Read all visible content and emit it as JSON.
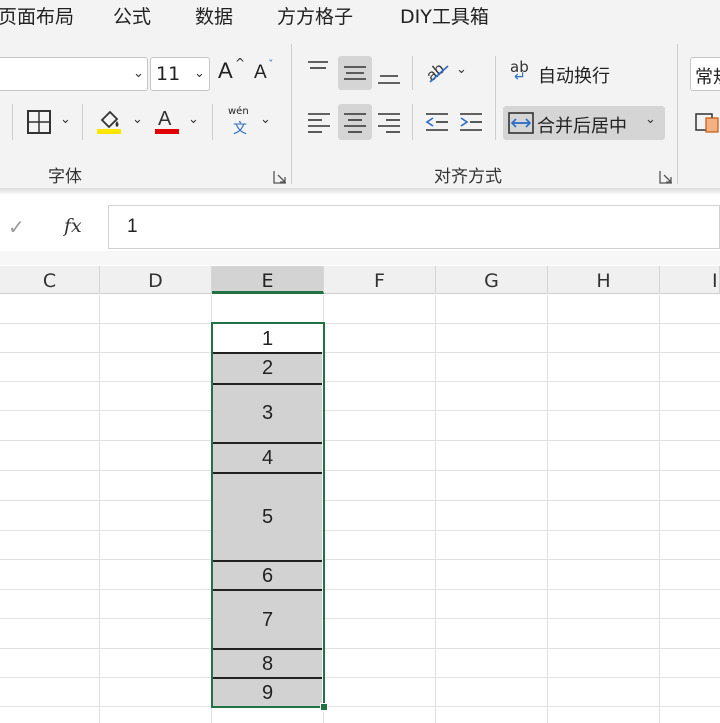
{
  "tabs": [
    "页面布局",
    "公式",
    "数据",
    "方方格子",
    "DIY工具箱"
  ],
  "font": {
    "size": "11",
    "increase_label": "A",
    "decrease_label": "A",
    "group_label": "字体",
    "fill_color": "#ffe600",
    "font_color": "#e00000",
    "phonetic_top": "wén",
    "phonetic_bottom": "文"
  },
  "alignment": {
    "wrap_label": "自动换行",
    "wrap_icon_text": "ab",
    "merge_label": "合并后居中",
    "group_label": "对齐方式"
  },
  "number": {
    "format_value": "常規"
  },
  "formula_bar": {
    "fx_label": "fx",
    "value": "1"
  },
  "columns": [
    "C",
    "D",
    "E",
    "F",
    "G",
    "H",
    "I"
  ],
  "active_column": "E",
  "merged_cells": [
    "1",
    "2",
    "3",
    "4",
    "5",
    "6",
    "7",
    "8",
    "9"
  ],
  "colors": {
    "accent": "#217346",
    "selection_fill": "#d2d2d2"
  }
}
